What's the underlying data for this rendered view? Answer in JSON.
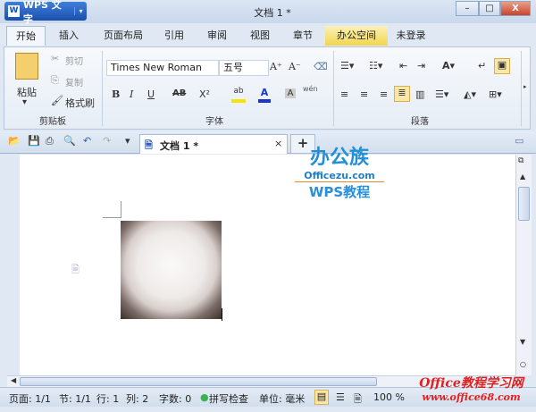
{
  "app": {
    "name": "WPS 文字",
    "title": "文档 1 *"
  },
  "window_controls": {
    "minimize": "–",
    "maximize": "□",
    "close": "X"
  },
  "tabs": [
    "开始",
    "插入",
    "页面布局",
    "引用",
    "审阅",
    "视图",
    "章节",
    "办公空间"
  ],
  "account": {
    "login": "未登录"
  },
  "ribbon": {
    "clipboard": {
      "label": "剪贴板",
      "paste": "粘贴",
      "cut": "剪切",
      "copy": "复制",
      "format_painter": "格式刷"
    },
    "font": {
      "label": "字体",
      "font_name": "Times New Roman",
      "font_size": "五号",
      "bold": "B",
      "italic": "I",
      "underline": "U",
      "strike": "AB",
      "superscript": "X²",
      "grow": "A⁺",
      "shrink": "A⁻",
      "font_color": "A",
      "shade": "A",
      "phonetic": "wén"
    },
    "paragraph": {
      "label": "段落"
    }
  },
  "document_tab": {
    "title": "文档 1 *",
    "close": "×",
    "new": "+"
  },
  "watermarks": {
    "logo_cn": "办公族",
    "logo_url": "Officezu.com",
    "logo_sub": "WPS教程",
    "site_cn": "Office教程学习网",
    "site_url": "www.office68.com"
  },
  "status": {
    "page": "页面: 1/1",
    "section": "节: 1/1",
    "row": "行: 1",
    "col": "列: 2",
    "words": "字数: 0",
    "spell": "拼写检查",
    "unit": "单位: 毫米",
    "zoom": "100 %"
  },
  "colors": {
    "accent": "#1a4fae",
    "office_tab": "#f2d54f",
    "font_color": "#1a35c4",
    "highlight": "#f5e400"
  }
}
